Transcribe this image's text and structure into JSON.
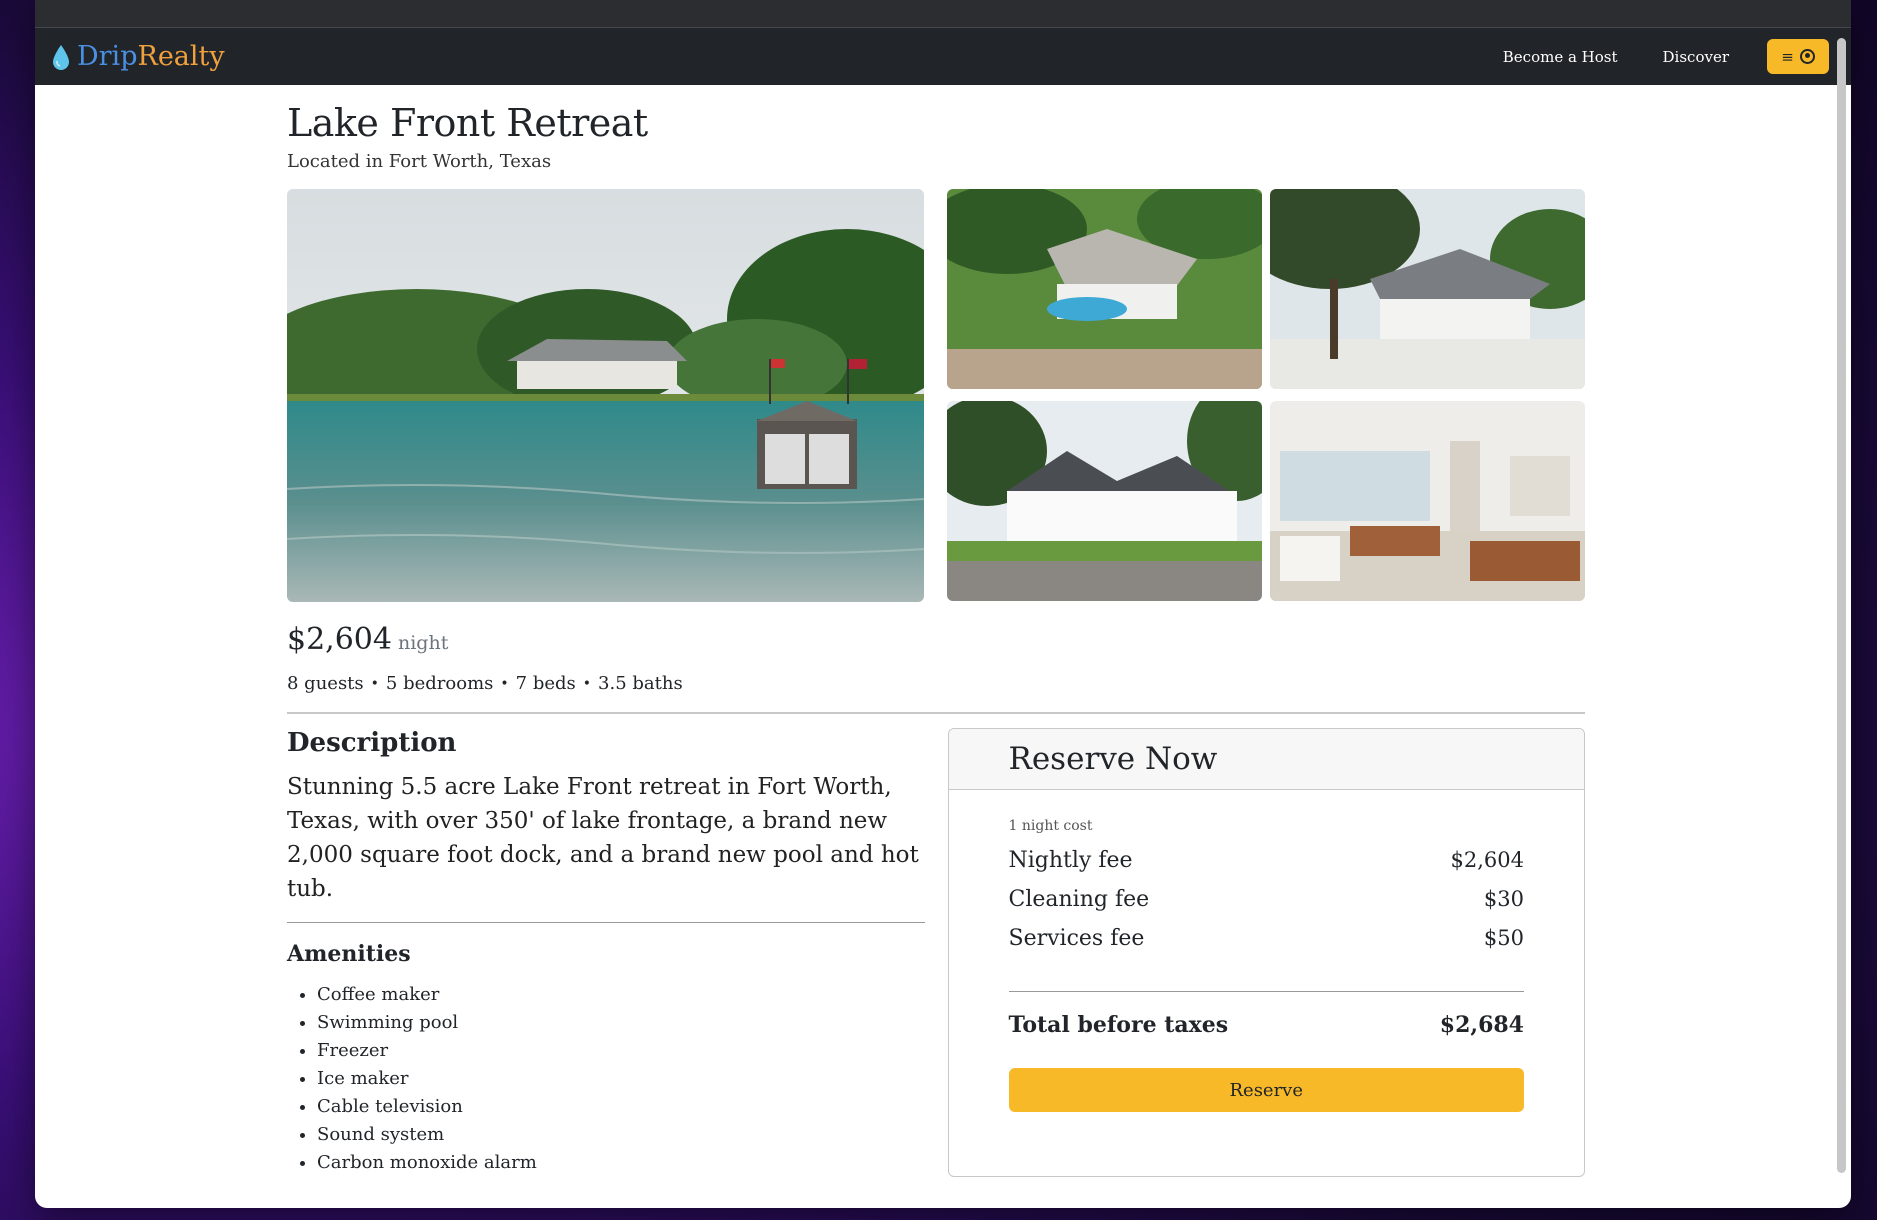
{
  "navbar": {
    "brand_part1": "Drip",
    "brand_part2": "Realty",
    "links": [
      "Become a Host",
      "Discover"
    ]
  },
  "listing": {
    "title": "Lake Front Retreat",
    "location": "Located in Fort Worth, Texas",
    "price": "$2,604",
    "price_unit": "night",
    "stats": [
      "8 guests",
      "5 bedrooms",
      "7 beds",
      "3.5 baths"
    ],
    "description_heading": "Description",
    "description": "Stunning 5.5 acre Lake Front retreat in Fort Worth, Texas, with over 350' of lake frontage, a brand new 2,000 square foot dock, and a brand new pool and hot tub.",
    "amenities_heading": "Amenities",
    "amenities": [
      "Coffee maker",
      "Swimming pool",
      "Freezer",
      "Ice maker",
      "Cable television",
      "Sound system",
      "Carbon monoxide alarm"
    ]
  },
  "reserve": {
    "heading": "Reserve Now",
    "cost_label": "1 night cost",
    "fees": [
      {
        "label": "Nightly fee",
        "value": "$2,604"
      },
      {
        "label": "Cleaning fee",
        "value": "$30"
      },
      {
        "label": "Services fee",
        "value": "$50"
      }
    ],
    "total_label": "Total before taxes",
    "total_value": "$2,684",
    "button_label": "Reserve"
  },
  "colors": {
    "accent": "#f7b928",
    "navbar": "#212529",
    "brand_blue": "#4a90e2",
    "brand_orange": "#f0a03c"
  }
}
